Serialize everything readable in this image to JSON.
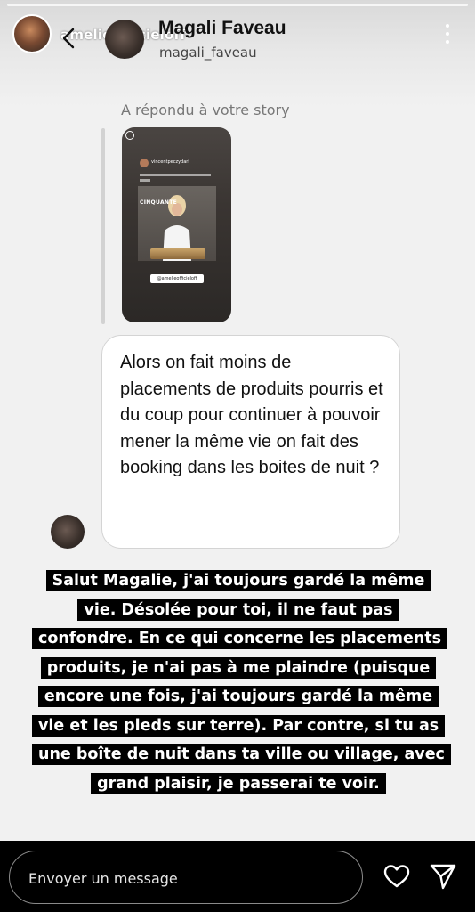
{
  "story_header": {
    "username": "amelieofficieloff"
  },
  "conversation_header": {
    "name": "Magali Faveau",
    "handle": "magali_faveau"
  },
  "reply_context": {
    "label": "A répondu à votre story",
    "thumbnail": {
      "user": "vincentpeczydarl",
      "title": "CINQUANTE",
      "tag": "@amelieofficieloff"
    }
  },
  "message": {
    "text": "Alors on fait moins de placements de produits pourris et du coup pour continuer à pouvoir mener la même vie on fait des booking dans les boites de nuit ?"
  },
  "story_reply": {
    "text": "Salut Magalie, j'ai toujours gardé la même vie. Désolée pour toi, il ne faut pas confondre. En ce qui concerne les placements produits, je n'ai pas à me plaindre (puisque encore une fois, j'ai toujours gardé la même vie et les pieds sur terre). Par contre, si tu as une boîte de nuit dans ta ville ou village, avec grand plaisir, je passerai te voir."
  },
  "composer": {
    "placeholder": "Envoyer un message"
  },
  "icons": {
    "back": "chevron-left-icon",
    "more": "more-vertical-icon",
    "like": "heart-icon",
    "send": "send-icon"
  },
  "colors": {
    "story_background": "#f1f1f1",
    "bubble_background": "#ffffff",
    "reply_highlight": "#000000",
    "reply_text": "#ffffff"
  }
}
